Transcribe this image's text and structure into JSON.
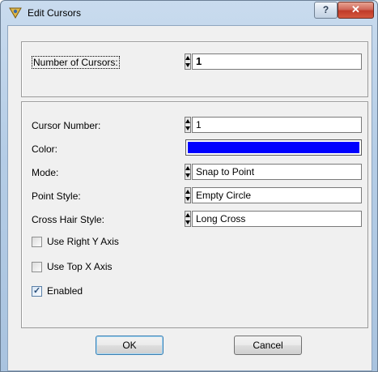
{
  "window": {
    "title": "Edit Cursors",
    "help_glyph": "?",
    "close_glyph": "✕"
  },
  "count_group": {
    "label": "Number of Cursors:",
    "value": "1"
  },
  "cursor_group": {
    "cursor_number_label": "Cursor Number:",
    "cursor_number_value": "1",
    "color_label": "Color:",
    "color_value": "#0000ff",
    "mode_label": "Mode:",
    "mode_value": "Snap to Point",
    "point_style_label": "Point Style:",
    "point_style_value": "Empty Circle",
    "cross_hair_label": "Cross Hair Style:",
    "cross_hair_value": "Long Cross",
    "use_right_y_label": "Use Right Y Axis",
    "use_right_y_checked": false,
    "use_top_x_label": "Use Top X Axis",
    "use_top_x_checked": false,
    "enabled_label": "Enabled",
    "enabled_checked": true
  },
  "buttons": {
    "ok_label": "OK",
    "cancel_label": "Cancel"
  },
  "icons": {
    "app_icon": "labview-app-icon",
    "spinner": "up-down-spinner-icon",
    "checkmark": "check-icon"
  }
}
